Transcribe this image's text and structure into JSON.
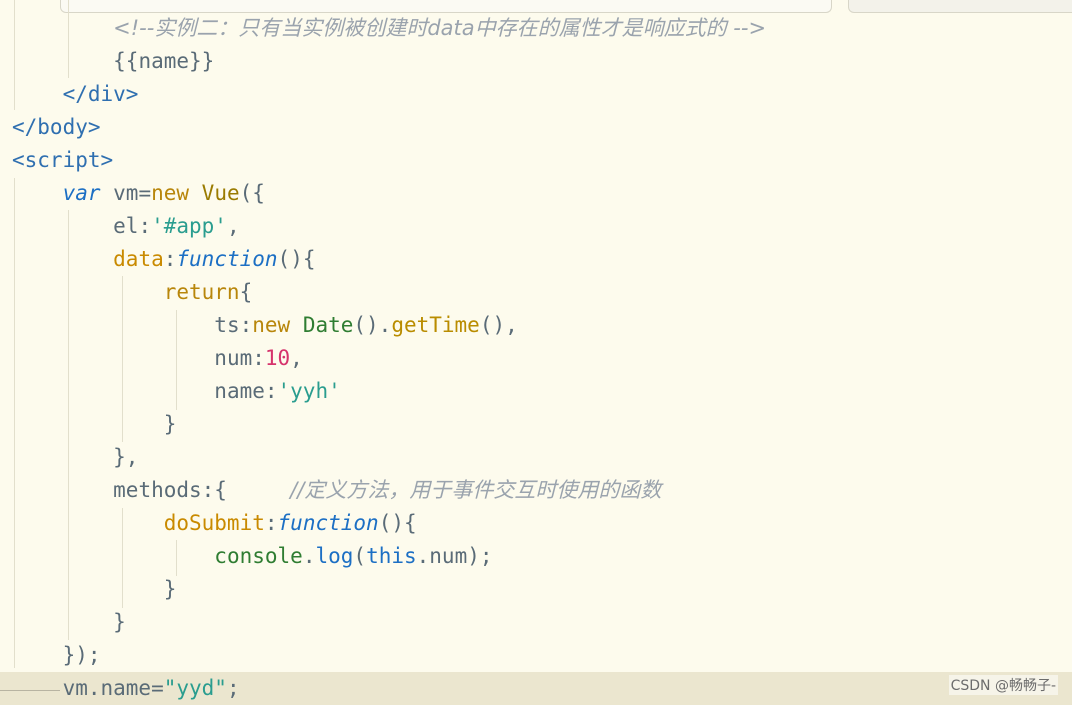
{
  "lines": {
    "l1_comment": "<!--实例二：只有当实例被创建时data中存在的属性才是响应式的 -->",
    "l2": "{{name}}",
    "l3": "</div>",
    "l4": "</body>",
    "l5": "<script>",
    "l6_kw": "var",
    "l6_a": " vm=",
    "l6_new": "new",
    "l6_cls": " Vue",
    "l6_b": "({",
    "l7_a": "el:",
    "l7_str": "'#app'",
    "l7_b": ",",
    "l8_name": "data",
    "l8_colon": ":",
    "l8_kw": "function",
    "l8_b": "(){",
    "l9_kw": "return",
    "l9_b": "{",
    "l10_a": "ts:",
    "l10_new": "new",
    "l10_obj": " Date",
    "l10_b": "().",
    "l10_m": "getTime",
    "l10_c": "(),",
    "l11_a": "num:",
    "l11_num": "10",
    "l11_b": ",",
    "l12_a": "name:",
    "l12_str": "'yyh'",
    "l13": "}",
    "l14": "},",
    "l15_a": "methods:{",
    "l15_cmt": "//定义方法，用于事件交互时使用的函数",
    "l16_name": "doSubmit",
    "l16_colon": ":",
    "l16_kw": "function",
    "l16_b": "(){",
    "l17_obj": "console",
    "l17_dot": ".",
    "l17_m": "log",
    "l17_p": "(",
    "l17_this": "this",
    "l17_b": ".num);",
    "l18": "}",
    "l19": "}",
    "l20": "});",
    "l21_a": "vm.name=",
    "l21_str": "\"yyd\"",
    "l21_b": ";"
  },
  "watermark": "CSDN @畅畅子-"
}
